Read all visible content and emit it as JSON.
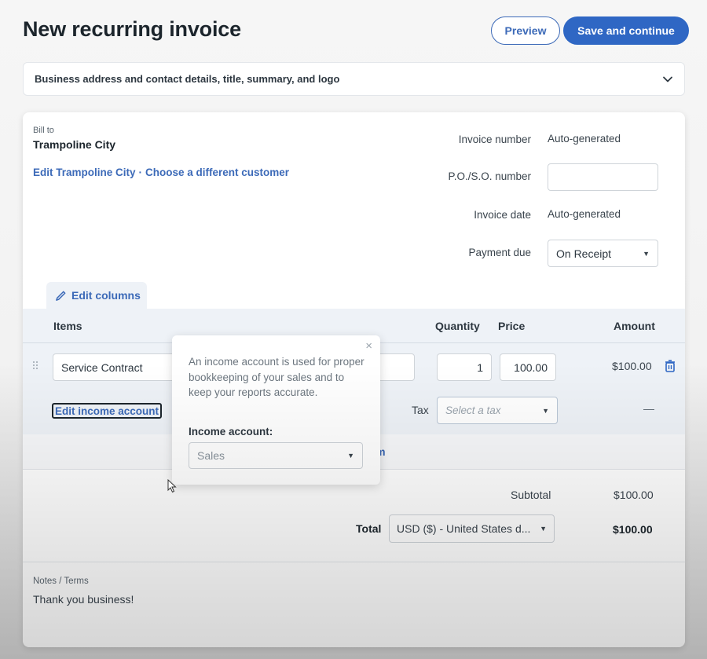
{
  "header": {
    "title": "New recurring invoice",
    "preview_label": "Preview",
    "save_label": "Save and continue"
  },
  "accordion": {
    "label": "Business address and contact details, title, summary, and logo",
    "icon": "chevron-down-icon"
  },
  "bill_to": {
    "label": "Bill to",
    "customer": "Trampoline City",
    "edit_link": "Edit Trampoline City",
    "separator": "·",
    "choose_link": "Choose a different customer"
  },
  "meta": {
    "invoice_number_label": "Invoice number",
    "invoice_number_value": "Auto-generated",
    "po_label": "P.O./S.O. number",
    "po_value": "",
    "invoice_date_label": "Invoice date",
    "invoice_date_value": "Auto-generated",
    "payment_due_label": "Payment due",
    "payment_due_value": "On Receipt"
  },
  "items": {
    "edit_columns_label": "Edit columns",
    "columns": {
      "items": "Items",
      "quantity": "Quantity",
      "price": "Price",
      "amount": "Amount"
    },
    "rows": [
      {
        "name": "Service Contract",
        "quantity": "1",
        "price": "100.00",
        "amount": "$100.00",
        "edit_income_label": "Edit income account",
        "tax_label": "Tax",
        "tax_placeholder": "Select a tax",
        "tax_amount": "—"
      }
    ],
    "add_item_label": "Add an item"
  },
  "totals": {
    "subtotal_label": "Subtotal",
    "subtotal_value": "$100.00",
    "total_label": "Total",
    "currency": "USD ($) - United States d...",
    "total_value": "$100.00"
  },
  "notes": {
    "label": "Notes / Terms",
    "text": "Thank you business!"
  },
  "popover": {
    "close": "×",
    "description": "An income account is used for proper bookkeeping of your sales and to keep your reports accurate.",
    "field_label": "Income account:",
    "field_value": "Sales"
  },
  "colors": {
    "accent": "#2f67c4",
    "link": "#3c6ab8",
    "items_bg": "#eef2f7"
  }
}
